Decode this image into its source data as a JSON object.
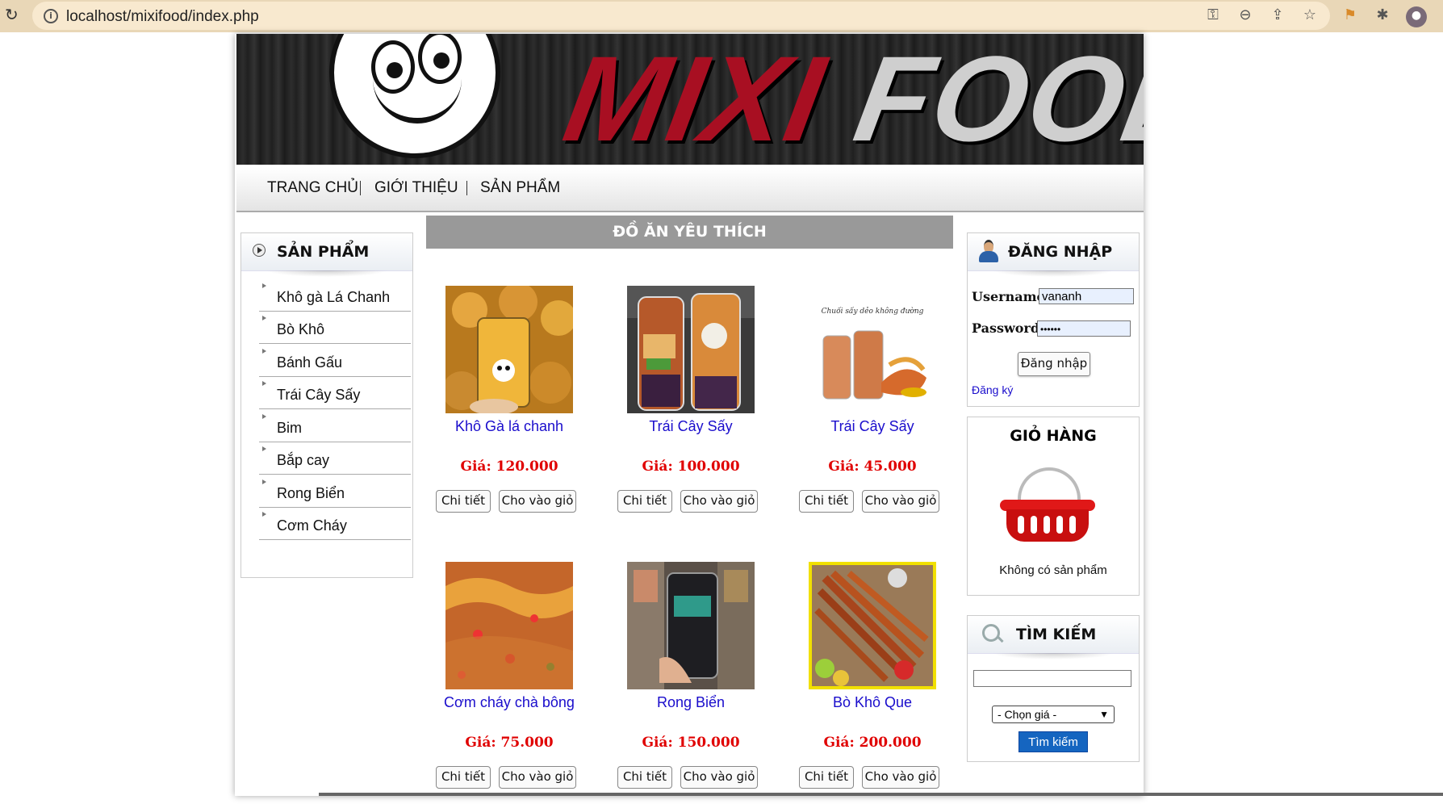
{
  "browser": {
    "url": "localhost/mixifood/index.php"
  },
  "banner": {
    "logo_left": "MIXI",
    "logo_right": "FOOD"
  },
  "nav": {
    "items": [
      "TRANG CHỦ",
      "GIỚI THIỆU",
      "SẢN PHẨM"
    ]
  },
  "sidebar": {
    "title": "SẢN PHẨM",
    "categories": [
      "Khô gà Lá Chanh",
      "Bò Khô",
      "Bánh Gấu",
      "Trái Cây Sấy",
      "Bim",
      "Bắp cay",
      "Rong Biển",
      "Cơm Cháy"
    ]
  },
  "main": {
    "section_title": "ĐỒ ĂN YÊU THÍCH",
    "detail_label": "Chi tiết",
    "cart_label": "Cho vào giỏ",
    "products": [
      {
        "name": "Khô Gà lá chanh",
        "price": "Giá: 120.000"
      },
      {
        "name": "Trái Cây Sấy",
        "price": "Giá: 100.000"
      },
      {
        "name": "Trái Cây Sấy",
        "price": "Giá: 45.000",
        "image_caption": "Chuối sấy dẻo không đường"
      },
      {
        "name": "Cơm cháy chà bông",
        "price": "Giá: 75.000"
      },
      {
        "name": "Rong Biển",
        "price": "Giá: 150.000"
      },
      {
        "name": "Bò Khô Que",
        "price": "Giá: 200.000"
      }
    ]
  },
  "login": {
    "title": "ĐĂNG NHẬP",
    "username_label": "Username:",
    "username_value": "vananh",
    "password_label": "Password:",
    "password_value": "••••••",
    "submit_label": "Đăng nhập",
    "register_link": "Đăng ký"
  },
  "cart": {
    "title": "GIỎ HÀNG",
    "empty_text": "Không có sản phẩm"
  },
  "search": {
    "title": "TÌM KIẾM",
    "query": "",
    "price_select": "- Chọn giá -",
    "button_label": "Tìm kiếm"
  },
  "colors": {
    "link": "#1a0dcc",
    "price": "#e00000",
    "logo_red": "#a80f22",
    "search_button": "#1565c0"
  }
}
